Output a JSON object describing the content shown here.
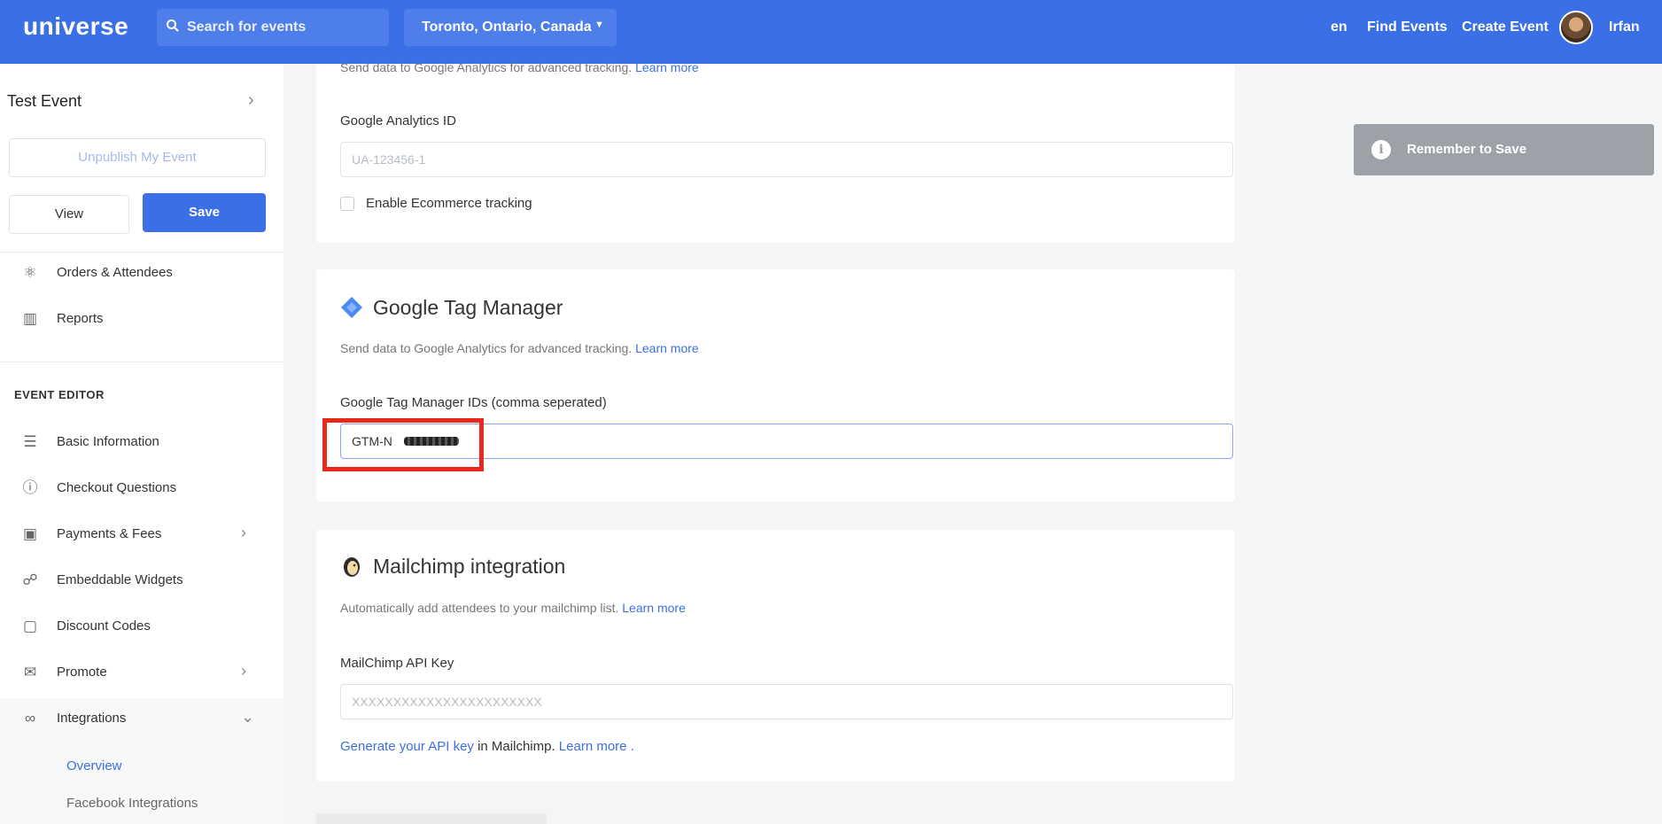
{
  "header": {
    "logo": "universe",
    "search_placeholder": "Search for events",
    "location": "Toronto, Ontario, Canada",
    "language": "en",
    "find_events": "Find Events",
    "create_event": "Create Event",
    "user_name": "Irfan"
  },
  "sidebar": {
    "event_title": "Test Event",
    "unpublish_label": "Unpublish My Event",
    "view_label": "View",
    "save_label": "Save",
    "top_items": [
      {
        "label": "Orders & Attendees",
        "icon": "tag-icon"
      },
      {
        "label": "Reports",
        "icon": "bar-chart-icon"
      }
    ],
    "section_label": "EVENT EDITOR",
    "items": [
      {
        "label": "Basic Information",
        "icon": "list-icon"
      },
      {
        "label": "Checkout Questions",
        "icon": "question-icon"
      },
      {
        "label": "Payments & Fees",
        "icon": "money-icon"
      },
      {
        "label": "Embeddable Widgets",
        "icon": "cart-icon"
      },
      {
        "label": "Discount Codes",
        "icon": "ticket-icon"
      },
      {
        "label": "Promote",
        "icon": "megaphone-icon"
      },
      {
        "label": "Integrations",
        "icon": "link-icon"
      }
    ],
    "sub_items": [
      {
        "label": "Overview",
        "active": true
      },
      {
        "label": "Facebook Integrations",
        "active": false
      }
    ]
  },
  "analytics": {
    "description": "Send data to Google Analytics for advanced tracking.",
    "learn_more": "Learn more",
    "id_label": "Google Analytics ID",
    "id_placeholder": "UA-123456-1",
    "ecommerce_label": "Enable Ecommerce tracking"
  },
  "gtm": {
    "title": "Google Tag Manager",
    "description": "Send data to Google Analytics for advanced tracking.",
    "learn_more": "Learn more",
    "ids_label": "Google Tag Manager IDs (comma seperated)",
    "ids_value": "GTM-N"
  },
  "mailchimp": {
    "title": "Mailchimp integration",
    "description": "Automatically add attendees to your mailchimp list.",
    "learn_more": "Learn more",
    "api_key_label": "MailChimp API Key",
    "api_key_placeholder": "XXXXXXXXXXXXXXXXXXXXXXX",
    "generate_link": "Generate your API key",
    "generate_suffix": "in Mailchimp.",
    "learn_more_2": "Learn more ."
  },
  "toast": {
    "message": "Remember to Save"
  },
  "colors": {
    "primary": "#3a6fe5",
    "highlight": "#e8281a",
    "toast_bg": "#9ea2a8"
  }
}
